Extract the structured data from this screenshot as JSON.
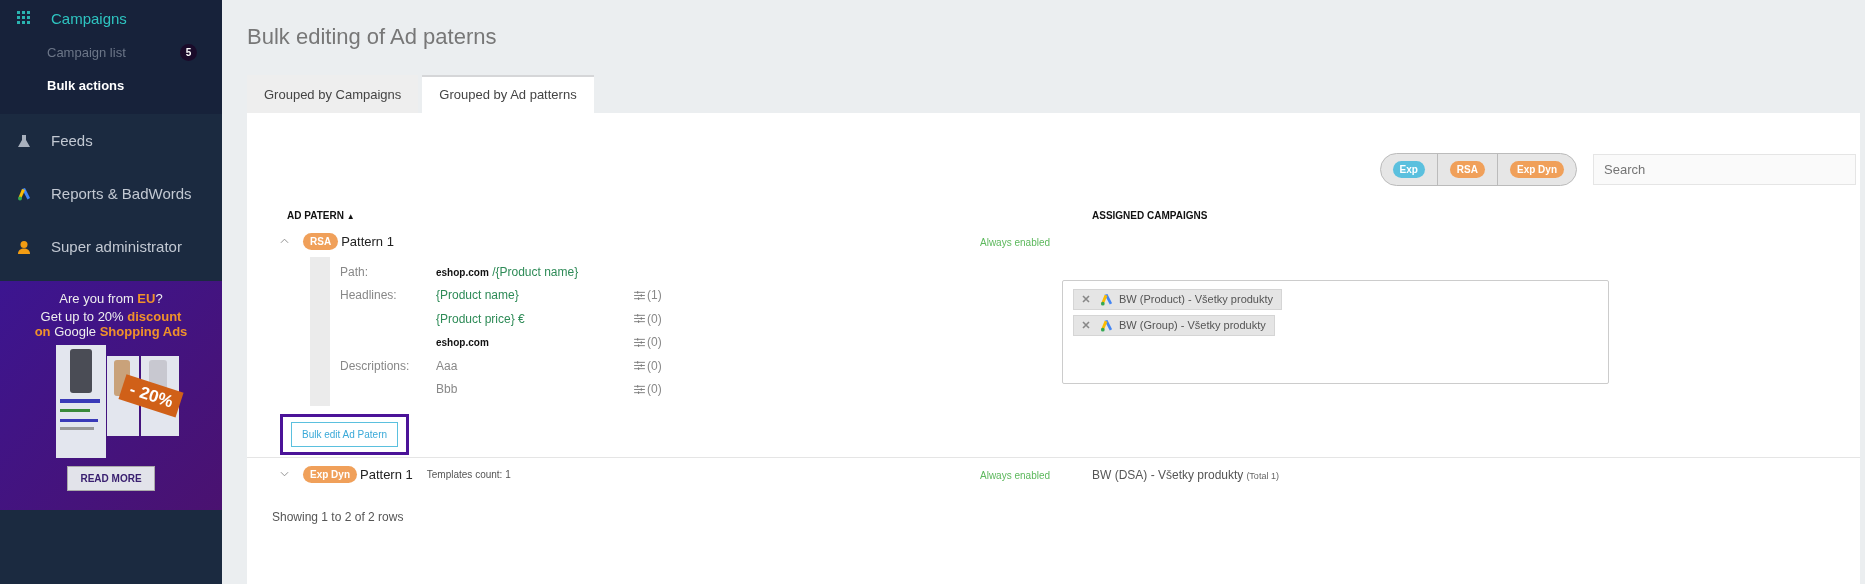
{
  "sidebar": {
    "sections": [
      {
        "label": "Campaigns",
        "expanded": true,
        "selected": true,
        "children": [
          {
            "label": "Campaign list",
            "badge": "5",
            "selected": false
          },
          {
            "label": "Bulk actions",
            "selected": true
          }
        ]
      },
      {
        "label": "Feeds",
        "expanded": false,
        "selected": false
      },
      {
        "label": "Reports & BadWords",
        "expanded": false,
        "selected": false
      },
      {
        "label": "Super administrator",
        "expanded": false,
        "selected": false
      }
    ],
    "promo": {
      "line_1": "Are you from **EU**?",
      "line_2": "Get up to 20% **discount**",
      "line_3": "**on** Google **Shopping Ads**",
      "sticker": "- 20%",
      "button": "READ MORE"
    }
  },
  "page": {
    "title": "Bulk editing of Ad paterns"
  },
  "tabs": [
    {
      "label": "Grouped by Campaigns",
      "selected": false
    },
    {
      "label": "Grouped by Ad patterns",
      "selected": true
    }
  ],
  "filters": [
    {
      "label": "Exp",
      "color": "#5bc0de"
    },
    {
      "label": "RSA",
      "color": "#f0a05a"
    },
    {
      "label": "Exp Dyn",
      "color": "#f0a05a"
    }
  ],
  "search": {
    "placeholder": "Search"
  },
  "table": {
    "columns": [
      {
        "label": "AD PATERN",
        "sort": "▲"
      },
      {
        "label": "ASSIGNED CAMPAIGNS"
      }
    ],
    "rows": [
      {
        "expanded": true,
        "type": {
          "label": "RSA",
          "color": "#f0a05a"
        },
        "name": "Pattern 1",
        "status": "Always enabled",
        "details": {
          "path_label": "Path:",
          "path_domain": "eshop.com",
          "path_value": "/{Product name}",
          "groups": [
            {
              "label": "Headlines:",
              "items": [
                {
                  "kind": "template",
                  "text": "{Product name}",
                  "count": "(1)"
                },
                {
                  "kind": "template",
                  "text": "{Product price} €",
                  "count": "(0)"
                },
                {
                  "kind": "static",
                  "text": "eshop.com",
                  "count": "(0)"
                }
              ]
            },
            {
              "label": "Descriptions:",
              "items": [
                {
                  "kind": "plain",
                  "text": "Aaa",
                  "count": "(0)"
                },
                {
                  "kind": "plain",
                  "text": "Bbb",
                  "count": "(0)"
                }
              ]
            }
          ]
        },
        "campaigns": [
          {
            "name": "BW (Product) - Všetky produkty"
          },
          {
            "name": "BW (Group) - Všetky produkty"
          }
        ],
        "button": "Bulk edit Ad Patern"
      },
      {
        "expanded": false,
        "type": {
          "label": "Exp Dyn",
          "color": "#f0a05a"
        },
        "name": "Pattern 1",
        "templates": "Templates count: 1",
        "status": "Always enabled",
        "assigned": "BW (DSA) - Všetky produkty",
        "assigned_total": "(Total 1)"
      }
    ]
  },
  "footer": {
    "summary": "Showing 1 to 2 of 2 rows"
  }
}
